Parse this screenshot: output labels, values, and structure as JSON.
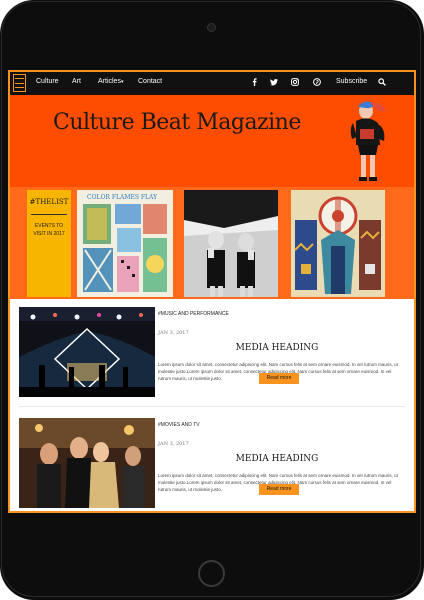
{
  "theme": {
    "accent": "#f7931e",
    "hero_background": "#ff4d00",
    "strip_background": "#ff6a1a",
    "list_card_background": "#f7b500",
    "navbar_background": "#111111"
  },
  "navbar": {
    "menu_icon": "hamburger-icon",
    "links": [
      "Culture",
      "Art",
      "Articles",
      "Contact"
    ],
    "articles_caret": "▾",
    "social_icons": [
      "facebook-icon",
      "twitter-icon",
      "instagram-icon",
      "pinterest-icon"
    ],
    "subscribe_label": "Subscribe",
    "search_icon": "search-icon"
  },
  "hero": {
    "title": "Culture Beat Magazine"
  },
  "featured": {
    "list_title": "#THELIST",
    "list_line1": "EVENTS TO",
    "list_line2": "VISIT IN 2017",
    "thumb_1_title": "COLOR FLAMES FLAY"
  },
  "articles": [
    {
      "category": "#MUSIC AND PERFORMANCE",
      "date": "JAN 3, 2017",
      "heading": "MEDIA HEADING",
      "excerpt": "Lorem ipsum dolor sit amet, consectetur adipiscing elit. Nam cursus felis at sem ornare euismod. In vel rutrum mauris, ut molestie justo.Lorem ipsum dolor sit amet, consectetur adipiscing elit. Nam cursus felis at sem ornare euismod. In vel rutrum mauris, ut molestie justo.",
      "button": "Read more"
    },
    {
      "category": "#MOVIES AND TV",
      "date": "JAN 3, 2017",
      "heading": "MEDIA HEADING",
      "excerpt": "Lorem ipsum dolor sit amet, consectetur adipiscing elit. Nam cursus felis at sem ornare euismod. In vel rutrum mauris, ut molestie justo.Lorem ipsum dolor sit amet, consectetur adipiscing elit. Nam cursus felis at sem ornare euismod. In vel rutrum mauris, ut molestie justo.",
      "button": "Read more"
    }
  ]
}
